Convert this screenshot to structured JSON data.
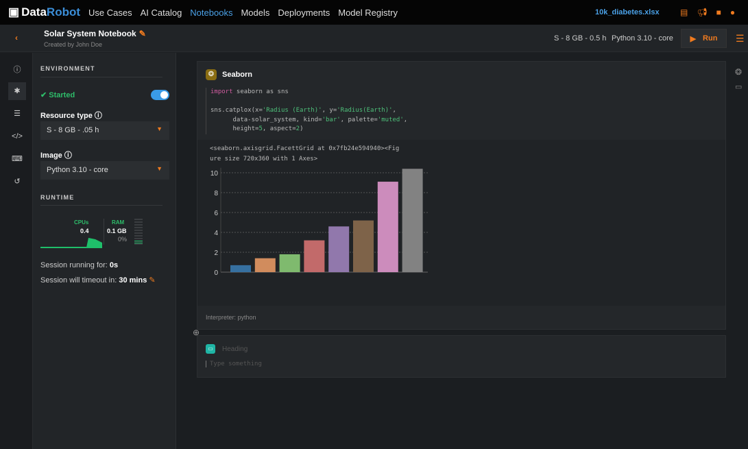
{
  "topbar": {
    "logo_a": "Data",
    "logo_b": "Robot",
    "nav": [
      "Use Cases",
      "AI Catalog",
      "Notebooks",
      "Models",
      "Deployments",
      "Model Registry"
    ],
    "active": "Notebooks",
    "file": "10k_diabetes.xlsx",
    "accent": "#f07b1f"
  },
  "header": {
    "title": "Solar System Notebook",
    "created": "Created by John Doe",
    "resource": "S - 8 GB - 0.5 h",
    "image": "Python 3.10 - core",
    "run": "Run"
  },
  "env": {
    "section": "ENVIRONMENT",
    "status": "Started",
    "resource_label": "Resource type",
    "resource_value": "S - 8 GB - .05 h",
    "image_label": "Image",
    "image_value": "Python 3.10 - core",
    "toggle_on": true
  },
  "runtime": {
    "section": "RUNTIME",
    "cpu_label": "CPUs",
    "cpu_value": "0.4",
    "ram_label": "RAM",
    "ram_value": "0.1 GB",
    "ram_pct": "0%",
    "running_label": "Session running for:",
    "running_value": "0s",
    "timeout_label": "Session will timeout in:",
    "timeout_value": "30 mins"
  },
  "cell1": {
    "title": "Seaborn",
    "code_kw": "import",
    "code_l1": " seaborn as sns",
    "code_l2a": "sns.catplox(x=",
    "code_s1": "'Radius (Earth)'",
    "code_l2b": ", y=",
    "code_s2": "'Radius(Earth)'",
    "code_l2c": ",",
    "code_l3a": "      data-solar_system, kind=",
    "code_s3": "'bar'",
    "code_l3b": ", palette=",
    "code_s4": "'muted'",
    "code_l3c": ",",
    "code_l4a": "      height=",
    "code_n1": "5",
    "code_l4b": ", aspect=",
    "code_n2": "2",
    "code_l4c": ")",
    "output": "<seaborn.axisgrid.FacettGrid at 0x7fb24e594940><Fig\nure size 720x360 with 1 Axes>",
    "interpreter": "Interpreter: python"
  },
  "cell2": {
    "heading_placeholder": "Heading",
    "body_placeholder": "Type something"
  },
  "chart_data": {
    "type": "bar",
    "values": [
      0.7,
      1.4,
      1.8,
      3.2,
      4.6,
      5.2,
      9.1,
      10.4
    ],
    "colors": [
      "#3670a0",
      "#d18c5d",
      "#7fba6e",
      "#c26a6a",
      "#9178ac",
      "#7e6349",
      "#cc8cbc",
      "#828282"
    ],
    "yticks": [
      "0",
      "2",
      "4",
      "6",
      "8",
      "10"
    ],
    "ylim": [
      0,
      10.5
    ],
    "grid": true
  }
}
